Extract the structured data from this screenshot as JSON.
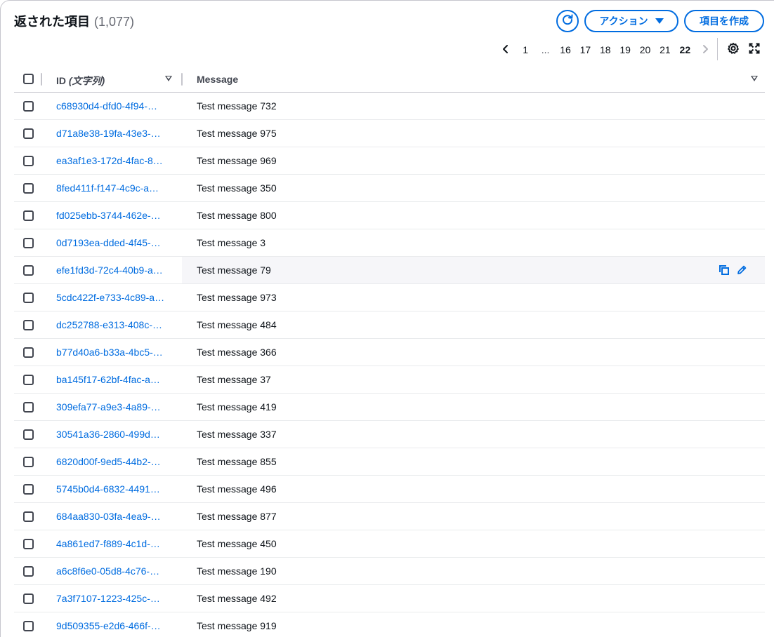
{
  "header": {
    "title": "返された項目",
    "count": "(1,077)",
    "actions_label": "アクション",
    "create_label": "項目を作成"
  },
  "pagination": {
    "pages": [
      "1",
      "...",
      "16",
      "17",
      "18",
      "19",
      "20",
      "21",
      "22"
    ],
    "current": "22"
  },
  "table": {
    "columns": {
      "id": "ID",
      "id_suffix": "(文字列)",
      "message": "Message"
    },
    "rows": [
      {
        "id": "c68930d4-dfd0-4f94-…",
        "message": "Test message 732"
      },
      {
        "id": "d71a8e38-19fa-43e3-…",
        "message": "Test message 975"
      },
      {
        "id": "ea3af1e3-172d-4fac-8…",
        "message": "Test message 969"
      },
      {
        "id": "8fed411f-f147-4c9c-a…",
        "message": "Test message 350"
      },
      {
        "id": "fd025ebb-3744-462e-…",
        "message": "Test message 800"
      },
      {
        "id": "0d7193ea-dded-4f45-…",
        "message": "Test message 3"
      },
      {
        "id": "efe1fd3d-72c4-40b9-a…",
        "message": "Test message 79"
      },
      {
        "id": "5cdc422f-e733-4c89-a…",
        "message": "Test message 973"
      },
      {
        "id": "dc252788-e313-408c-…",
        "message": "Test message 484"
      },
      {
        "id": "b77d40a6-b33a-4bc5-…",
        "message": "Test message 366"
      },
      {
        "id": "ba145f17-62bf-4fac-a…",
        "message": "Test message 37"
      },
      {
        "id": "309efa77-a9e3-4a89-…",
        "message": "Test message 419"
      },
      {
        "id": "30541a36-2860-499d…",
        "message": "Test message 337"
      },
      {
        "id": "6820d00f-9ed5-44b2-…",
        "message": "Test message 855"
      },
      {
        "id": "5745b0d4-6832-4491…",
        "message": "Test message 496"
      },
      {
        "id": "684aa830-03fa-4ea9-…",
        "message": "Test message 877"
      },
      {
        "id": "4a861ed7-f889-4c1d-…",
        "message": "Test message 450"
      },
      {
        "id": "a6c8f6e0-05d8-4c76-…",
        "message": "Test message 190"
      },
      {
        "id": "7a3f7107-1223-425c-…",
        "message": "Test message 492"
      },
      {
        "id": "9d509355-e2d6-466f-…",
        "message": "Test message 919"
      }
    ],
    "hovered_row": 6
  },
  "colors": {
    "accent": "#006ce0",
    "text": "#0f141a",
    "muted": "#656871",
    "border": "#c6c6cd"
  },
  "icons": {
    "refresh": "refresh-icon",
    "prev": "chevron-left-icon",
    "next": "chevron-right-icon",
    "settings": "gear-icon",
    "fullscreen": "fullscreen-icon",
    "copy": "copy-icon",
    "edit": "pencil-icon"
  }
}
